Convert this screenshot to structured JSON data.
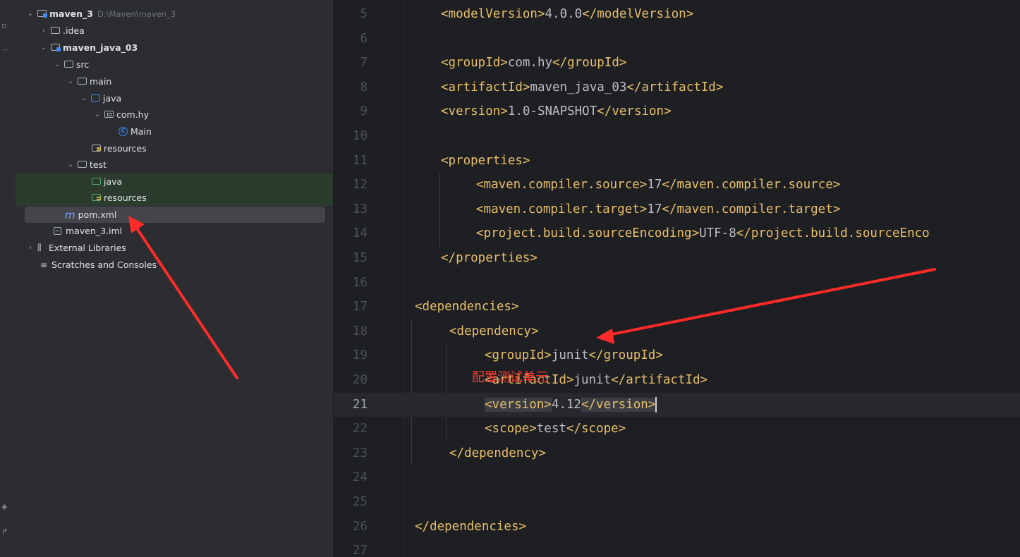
{
  "tree": {
    "items": [
      {
        "label": "maven_3",
        "path": "D:\\Maven\\maven_3"
      },
      {
        "label": ".idea"
      },
      {
        "label": "maven_java_03"
      },
      {
        "label": "src"
      },
      {
        "label": "main"
      },
      {
        "label": "java"
      },
      {
        "label": "com.hy"
      },
      {
        "label": "Main"
      },
      {
        "label": "resources"
      },
      {
        "label": "test"
      },
      {
        "label": "java"
      },
      {
        "label": "resources"
      },
      {
        "label": "pom.xml"
      },
      {
        "label": "maven_3.iml"
      },
      {
        "label": "External Libraries"
      },
      {
        "label": "Scratches and Consoles"
      }
    ]
  },
  "editor": {
    "lines": [
      {
        "no": "5",
        "tag1": "<modelVersion>",
        "text": "4.0.0",
        "tag2": "</modelVersion>"
      },
      {
        "no": "6"
      },
      {
        "no": "7",
        "tag1": "<groupId>",
        "text": "com.hy",
        "tag2": "</groupId>"
      },
      {
        "no": "8",
        "tag1": "<artifactId>",
        "text": "maven_java_03",
        "tag2": "</artifactId>"
      },
      {
        "no": "9",
        "tag1": "<version>",
        "text": "1.0-SNAPSHOT",
        "tag2": "</version>"
      },
      {
        "no": "10"
      },
      {
        "no": "11",
        "tag1": "<properties>"
      },
      {
        "no": "12",
        "tag1": "<maven.compiler.source>",
        "text": "17",
        "tag2": "</maven.compiler.source>"
      },
      {
        "no": "13",
        "tag1": "<maven.compiler.target>",
        "text": "17",
        "tag2": "</maven.compiler.target>"
      },
      {
        "no": "14",
        "tag1": "<project.build.sourceEncoding>",
        "text": "UTF-8",
        "tag2": "</project.build.sourceEnco"
      },
      {
        "no": "15",
        "tag1": "</properties>"
      },
      {
        "no": "16"
      },
      {
        "no": "17",
        "tag1": "<dependencies>"
      },
      {
        "no": "18",
        "tag1": "<dependency>"
      },
      {
        "no": "19",
        "tag1": "<groupId>",
        "text": "junit",
        "tag2": "</groupId>"
      },
      {
        "no": "20",
        "tag1": "<artifactId>",
        "text": "junit",
        "tag2": "</artifactId>"
      },
      {
        "no": "21",
        "tag1": "<version>",
        "text": "4.12",
        "tag2": "</version>"
      },
      {
        "no": "22",
        "tag1": "<scope>",
        "text": "test",
        "tag2": "</scope>"
      },
      {
        "no": "23",
        "tag1": "</dependency>"
      },
      {
        "no": "24"
      },
      {
        "no": "25"
      },
      {
        "no": "26",
        "tag1": "</dependencies>"
      },
      {
        "no": "27"
      }
    ]
  },
  "annotation": {
    "note": "配置测试单元",
    "color": "#ff3b30"
  },
  "colors": {
    "tag": "#e8bf6a",
    "text": "#bcbec4",
    "background": "#1e1f22",
    "panel": "#2b2d30",
    "selection": "#43454a"
  }
}
